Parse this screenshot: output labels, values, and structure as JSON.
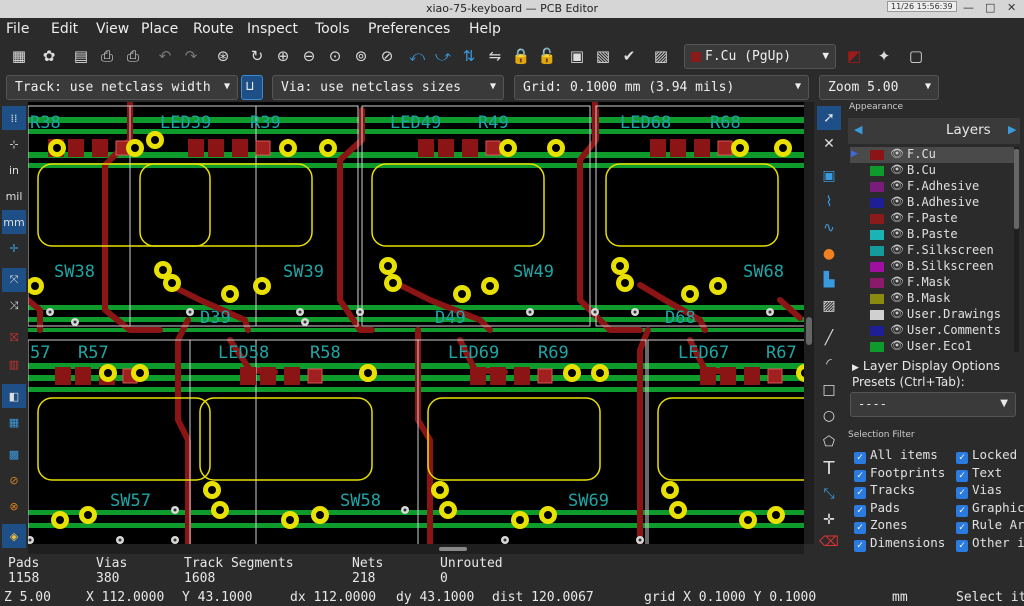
{
  "window": {
    "title": "xiao-75-keyboard — PCB Editor",
    "clock": "11/26  15:56:39"
  },
  "menu": [
    "File",
    "Edit",
    "View",
    "Place",
    "Route",
    "Inspect",
    "Tools",
    "Preferences",
    "Help"
  ],
  "toolbar": {
    "active_layer": "F.Cu (PgUp)"
  },
  "options": {
    "track": "Track: use netclass width",
    "via": "Via: use netclass sizes",
    "grid": "Grid: 0.1000 mm (3.94 mils)",
    "zoom": "Zoom 5.00"
  },
  "left_toolbar": {
    "inch": "in",
    "mil": "mil",
    "mm": "mm"
  },
  "canvas": {
    "labels": [
      "R38",
      "LED39",
      "R39",
      "LED49",
      "R49",
      "LED68",
      "R68",
      "SW38",
      "SW39",
      "SW49",
      "SW68",
      "D39",
      "D49",
      "D68",
      "57",
      "R57",
      "LED58",
      "R58",
      "LED69",
      "R69",
      "LED67",
      "R67",
      "SW57",
      "SW58",
      "SW69"
    ],
    "colors": {
      "fcu": "#8b1515",
      "bcu": "#0e9b2c",
      "silk": "#1fa5a5",
      "pad": "#e8e000",
      "drill": "#000000"
    }
  },
  "appearance": {
    "header": "Appearance",
    "tab": "Layers",
    "layers": [
      {
        "name": "F.Cu",
        "color": "#8b1515"
      },
      {
        "name": "B.Cu",
        "color": "#0e9b2c"
      },
      {
        "name": "F.Adhesive",
        "color": "#7a1d7a"
      },
      {
        "name": "B.Adhesive",
        "color": "#1e1e96"
      },
      {
        "name": "F.Paste",
        "color": "#8b1a1a"
      },
      {
        "name": "B.Paste",
        "color": "#1ab4b4"
      },
      {
        "name": "F.Silkscreen",
        "color": "#159b9b"
      },
      {
        "name": "B.Silkscreen",
        "color": "#a010a0"
      },
      {
        "name": "F.Mask",
        "color": "#8b1a6a"
      },
      {
        "name": "B.Mask",
        "color": "#8a8a10"
      },
      {
        "name": "User.Drawings",
        "color": "#d0d0d0"
      },
      {
        "name": "User.Comments",
        "color": "#1e1e96"
      },
      {
        "name": "User.Eco1",
        "color": "#0e9b2c"
      }
    ],
    "display_options": "Layer Display Options",
    "presets_label": "Presets (Ctrl+Tab):",
    "presets_value": "----",
    "filter_label": "Selection Filter",
    "filters_left": [
      "All items",
      "Footprints",
      "Tracks",
      "Pads",
      "Zones",
      "Dimensions"
    ],
    "filters_right": [
      "Locked",
      "Text",
      "Vias",
      "Graphics",
      "Rule Areas",
      "Other items"
    ]
  },
  "stats": {
    "pads_label": "Pads",
    "pads": "1158",
    "vias_label": "Vias",
    "vias": "380",
    "tracks_label": "Track Segments",
    "tracks": "1608",
    "nets_label": "Nets",
    "nets": "218",
    "unrouted_label": "Unrouted",
    "unrouted": "0"
  },
  "status": {
    "z": "Z 5.00",
    "x": "X 112.0000",
    "y": "Y 43.1000",
    "dx": "dx 112.0000",
    "dy": "dy 43.1000",
    "dist": "dist 120.0067",
    "grid": "grid X 0.1000  Y 0.1000",
    "units": "mm",
    "hint": "Select it"
  }
}
